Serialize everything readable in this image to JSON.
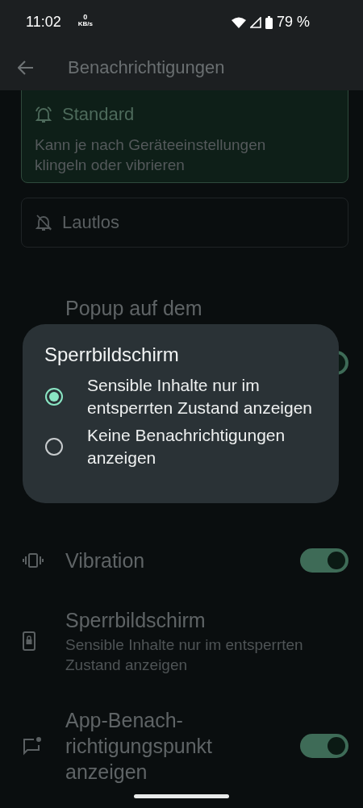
{
  "status_bar": {
    "time": "11:02",
    "net_speed": {
      "value": "0",
      "unit": "KB/s"
    },
    "battery": "79 %"
  },
  "app_bar": {
    "title": "Benachrichtigungen"
  },
  "behavior_options": [
    {
      "title": "Standard",
      "description": "Kann je nach Geräteeinstellungen klingeln oder vibrieren",
      "selected": true
    },
    {
      "title": "Lautlos",
      "selected": false
    }
  ],
  "settings": [
    {
      "kind": "toggle",
      "title": "Popup auf dem",
      "on": true
    },
    {
      "kind": "toggle",
      "title": "Vibration",
      "on": true
    },
    {
      "kind": "text",
      "title": "Sperrbildschirm",
      "summary": "Sensible Inhalte nur im entsperrten Zustand anzeigen"
    },
    {
      "kind": "toggle",
      "title": "App-Benach-richtigungspunkt anzeigen",
      "on": true
    }
  ],
  "dialog": {
    "title": "Sperrbildschirm",
    "options": [
      {
        "label": "Sensible Inhalte nur im entsperrten Zustand anzeigen",
        "selected": true
      },
      {
        "label": "Keine Benachrichtigungen anzeigen",
        "selected": false
      }
    ]
  }
}
